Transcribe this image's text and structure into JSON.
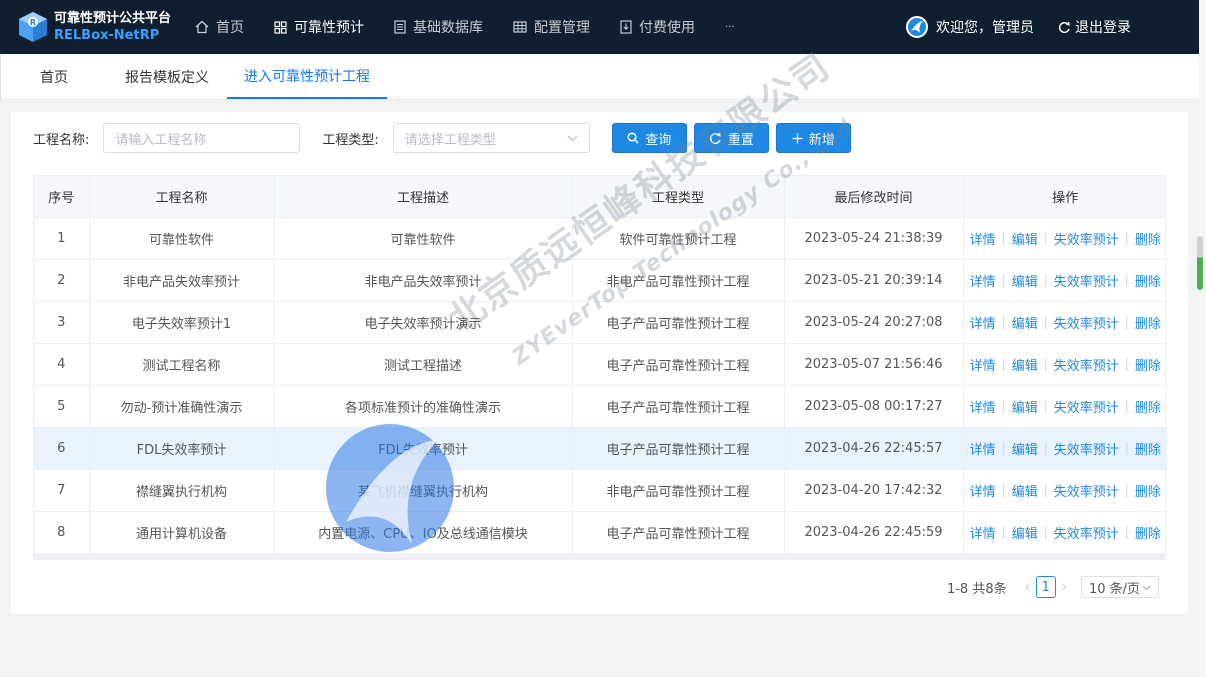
{
  "app": {
    "logo_line1": "可靠性预计公共平台",
    "logo_line2": "RELBox-NetRP",
    "colors": {
      "header_bg": "#0f1f2f",
      "accent": "#1e88e5",
      "row_highlight": "#e8f3fd"
    }
  },
  "nav": {
    "items": [
      {
        "label": "首页",
        "icon": "home-icon"
      },
      {
        "label": "可靠性预计",
        "icon": "grid-icon"
      },
      {
        "label": "基础数据库",
        "icon": "document-icon"
      },
      {
        "label": "配置管理",
        "icon": "table-icon"
      },
      {
        "label": "付费使用",
        "icon": "download-box-icon"
      },
      {
        "label": "···"
      }
    ],
    "welcome": "欢迎您，管理员",
    "logout": "退出登录"
  },
  "tabs": [
    {
      "label": "首页"
    },
    {
      "label": "报告模板定义"
    },
    {
      "label": "进入可靠性预计工程"
    }
  ],
  "search": {
    "name_label": "工程名称:",
    "name_placeholder": "请输入工程名称",
    "type_label": "工程类型:",
    "type_placeholder": "请选择工程类型",
    "query_button": "查询",
    "reset_button": "重置",
    "add_button": "新增"
  },
  "table": {
    "headers": [
      "序号",
      "工程名称",
      "工程描述",
      "工程类型",
      "最后修改时间",
      "操作"
    ],
    "actions": {
      "detail": "详情",
      "edit": "编辑",
      "failure_rate": "失效率预计",
      "delete": "删除"
    },
    "rows": [
      {
        "no": "1",
        "name": "可靠性软件",
        "desc": "可靠性软件",
        "type": "软件可靠性预计工程",
        "time": "2023-05-24 21:38:39"
      },
      {
        "no": "2",
        "name": "非电产品失效率预计",
        "desc": "非电产品失效率预计",
        "type": "非电产品可靠性预计工程",
        "time": "2023-05-21 20:39:14"
      },
      {
        "no": "3",
        "name": "电子失效率预计1",
        "desc": "电子失效率预计演示",
        "type": "电子产品可靠性预计工程",
        "time": "2023-05-24 20:27:08"
      },
      {
        "no": "4",
        "name": "测试工程名称",
        "desc": "测试工程描述",
        "type": "电子产品可靠性预计工程",
        "time": "2023-05-07 21:56:46"
      },
      {
        "no": "5",
        "name": "勿动-预计准确性演示",
        "desc": "各项标准预计的准确性演示",
        "type": "电子产品可靠性预计工程",
        "time": "2023-05-08 00:17:27"
      },
      {
        "no": "6",
        "name": "FDL失效率预计",
        "desc": "FDL失效率预计",
        "type": "电子产品可靠性预计工程",
        "time": "2023-04-26 22:45:57"
      },
      {
        "no": "7",
        "name": "襟缝翼执行机构",
        "desc": "某飞机襟缝翼执行机构",
        "type": "非电产品可靠性预计工程",
        "time": "2023-04-20 17:42:32"
      },
      {
        "no": "8",
        "name": "通用计算机设备",
        "desc": "内置电源、CPU、IO及总线通信模块",
        "type": "电子产品可靠性预计工程",
        "time": "2023-04-26 22:45:59"
      }
    ]
  },
  "pager": {
    "total": "1-8 共8条",
    "current_page": "1",
    "page_size": "10 条/页"
  },
  "watermark": {
    "line1": "北京质远恒峰科技有限公司",
    "line2": "ZYEverTop Technology Co., Ltd"
  }
}
